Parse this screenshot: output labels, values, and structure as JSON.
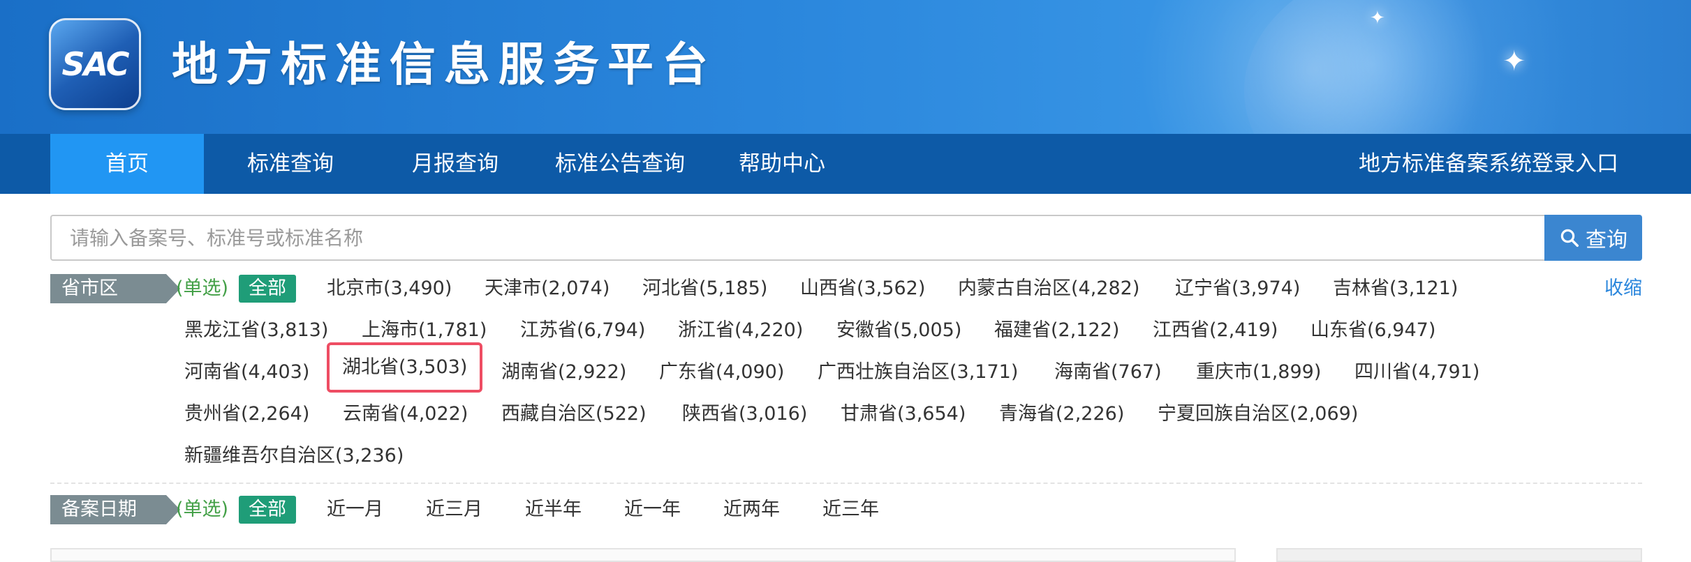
{
  "header": {
    "logo_text": "SAC",
    "site_title": "地方标准信息服务平台"
  },
  "nav": {
    "items": [
      {
        "label": "首页",
        "active": true
      },
      {
        "label": "标准查询",
        "active": false
      },
      {
        "label": "月报查询",
        "active": false
      },
      {
        "label": "标准公告查询",
        "active": false
      },
      {
        "label": "帮助中心",
        "active": false
      }
    ],
    "login_label": "地方标准备案系统登录入口"
  },
  "search": {
    "placeholder": "请输入备案号、标准号或标准名称",
    "value": "",
    "button_label": "查询",
    "button_icon": "search-icon"
  },
  "region_filter": {
    "label": "省市区",
    "mode": "(单选)",
    "all_label": "全部",
    "collapse_label": "收缩",
    "highlighted": "湖北省(3,503)",
    "highlight_color": "#ee4d63",
    "options": [
      "北京市(3,490)",
      "天津市(2,074)",
      "河北省(5,185)",
      "山西省(3,562)",
      "内蒙古自治区(4,282)",
      "辽宁省(3,974)",
      "吉林省(3,121)",
      "黑龙江省(3,813)",
      "上海市(1,781)",
      "江苏省(6,794)",
      "浙江省(4,220)",
      "安徽省(5,005)",
      "福建省(2,122)",
      "江西省(2,419)",
      "山东省(6,947)",
      "河南省(4,403)",
      "湖北省(3,503)",
      "湖南省(2,922)",
      "广东省(4,090)",
      "广西壮族自治区(3,171)",
      "海南省(767)",
      "重庆市(1,899)",
      "四川省(4,791)",
      "贵州省(2,264)",
      "云南省(4,022)",
      "西藏自治区(522)",
      "陕西省(3,016)",
      "甘肃省(3,654)",
      "青海省(2,226)",
      "宁夏回族自治区(2,069)",
      "新疆维吾尔自治区(3,236)"
    ]
  },
  "date_filter": {
    "label": "备案日期",
    "mode": "(单选)",
    "all_label": "全部",
    "options": [
      "近一月",
      "近三月",
      "近半年",
      "近一年",
      "近两年",
      "近三年"
    ]
  },
  "colors": {
    "nav_bg": "#0d5aa7",
    "nav_active": "#2196f3",
    "all_tag": "#1f9d78",
    "single_tag": "#43a047",
    "link": "#2a86dc"
  }
}
